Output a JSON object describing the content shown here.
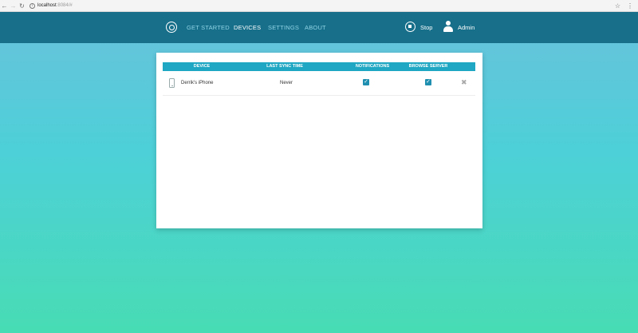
{
  "browser": {
    "url_host": "localhost",
    "url_rest": ":8084/#"
  },
  "header": {
    "nav": [
      {
        "label": "GET STARTED"
      },
      {
        "label": "DEVICES"
      },
      {
        "label": "SETTINGS"
      },
      {
        "label": "ABOUT"
      }
    ],
    "stop_label": "Stop",
    "user_label": "Admin"
  },
  "table": {
    "columns": [
      "DEVICE",
      "LAST SYNC TIME",
      "NOTIFICATIONS",
      "BROWSE SERVER"
    ],
    "rows": [
      {
        "device": "Derrik's iPhone",
        "last_sync": "Never",
        "notifications": true,
        "browse_server": true
      }
    ]
  },
  "icons": {
    "check": "✓",
    "remove": "✖"
  },
  "colors": {
    "header_bg": "#176f8a",
    "table_header_bg": "#1fa7c3",
    "checkbox": "#1f8fb0",
    "active_nav": "#ffffff",
    "inactive_nav": "#8fd3e4"
  }
}
